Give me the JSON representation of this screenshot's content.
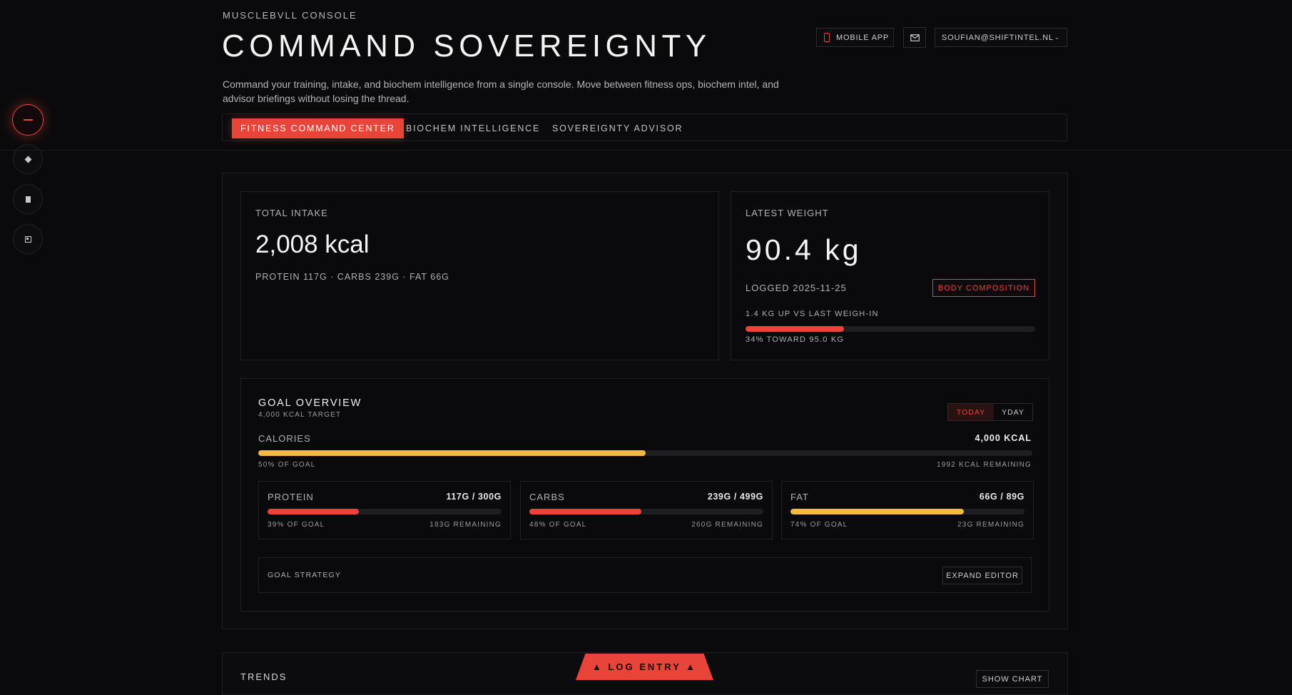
{
  "colors": {
    "accent": "#e8443a",
    "yellow": "#f5b942",
    "bg": "#0a0a0c"
  },
  "header": {
    "brand": "MUSCLEBVLL CONSOLE",
    "title": "COMMAND SOVEREIGNTY",
    "description": "Command your training, intake, and biochem intelligence from a single console. Move between fitness ops, biochem intel, and advisor briefings without losing the thread.",
    "mobile_app": "MOBILE APP",
    "mail_icon": "mail-icon",
    "account": "SOUFIAN@SHIFTINTEL.NL"
  },
  "rail": [
    "minus-icon",
    "diamond-icon",
    "square-icon",
    "target-icon"
  ],
  "tabs": [
    {
      "label": "FITNESS COMMAND CENTER",
      "active": true
    },
    {
      "label": "BIOCHEM INTELLIGENCE",
      "active": false
    },
    {
      "label": "SOVEREIGNTY ADVISOR",
      "active": false
    }
  ],
  "intake": {
    "label": "TOTAL INTAKE",
    "value": "2,008 kcal",
    "macros": "PROTEIN 117G · CARBS 239G · FAT 66G"
  },
  "weight": {
    "label": "LATEST WEIGHT",
    "value": "90.4 kg",
    "logged": "LOGGED 2025-11-25",
    "button": "BODY COMPOSITION",
    "delta": "1.4 KG UP VS LAST WEIGH-IN",
    "progress": 0.34,
    "progress_label": "34% TOWARD 95.0 KG"
  },
  "goal": {
    "title": "GOAL OVERVIEW",
    "subtitle": "4,000 KCAL TARGET",
    "toggle_today": "TODAY",
    "toggle_yday": "YDAY",
    "calories_label": "CALORIES",
    "calories_goal": "4,000 KCAL",
    "calories_progress": 0.5,
    "calories_pct": "50% OF GOAL",
    "calories_remaining": "1992 KCAL REMAINING",
    "macros": [
      {
        "name": "PROTEIN",
        "value": "117G / 300G",
        "progress": 0.39,
        "pct": "39% OF GOAL",
        "remaining": "183G REMAINING",
        "color": "#e8443a"
      },
      {
        "name": "CARBS",
        "value": "239G / 499G",
        "progress": 0.48,
        "pct": "48% OF GOAL",
        "remaining": "260G REMAINING",
        "color": "#e8443a"
      },
      {
        "name": "FAT",
        "value": "66G / 89G",
        "progress": 0.74,
        "pct": "74% OF GOAL",
        "remaining": "23G REMAINING",
        "color": "#f5b942"
      }
    ],
    "strategy_label": "GOAL STRATEGY",
    "expand_editor": "EXPAND EDITOR"
  },
  "trends": {
    "title": "TRENDS",
    "show_chart": "SHOW CHART"
  },
  "log_entry": "▲ LOG ENTRY ▲"
}
